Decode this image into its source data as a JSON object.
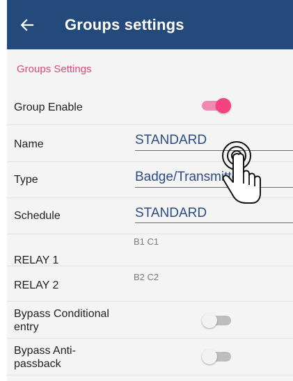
{
  "appbar": {
    "title": "Groups settings"
  },
  "section": {
    "title": "Groups Settings"
  },
  "rows": {
    "group_enable": {
      "label": "Group Enable",
      "enabled": true
    },
    "name": {
      "label": "Name",
      "value": "STANDARD"
    },
    "type": {
      "label": "Type",
      "value": "Badge/Transmitter"
    },
    "schedule": {
      "label": "Schedule",
      "value": "STANDARD"
    },
    "relay1": {
      "label": "RELAY 1",
      "value": "B1 C1"
    },
    "relay2": {
      "label": "RELAY 2",
      "value": "B2 C2"
    },
    "bypass_conditional": {
      "label": "Bypass Conditional entry",
      "enabled": false
    },
    "bypass_antipassback": {
      "label": "Bypass Anti-passback",
      "enabled": false
    }
  },
  "colors": {
    "appbar": "#244a7c",
    "accent_pink": "#f5437f",
    "section_title": "#e0457b",
    "value_text": "#2c4c85"
  },
  "icons": {
    "back": "arrow-left-icon",
    "gesture": "tap-hand-icon"
  }
}
